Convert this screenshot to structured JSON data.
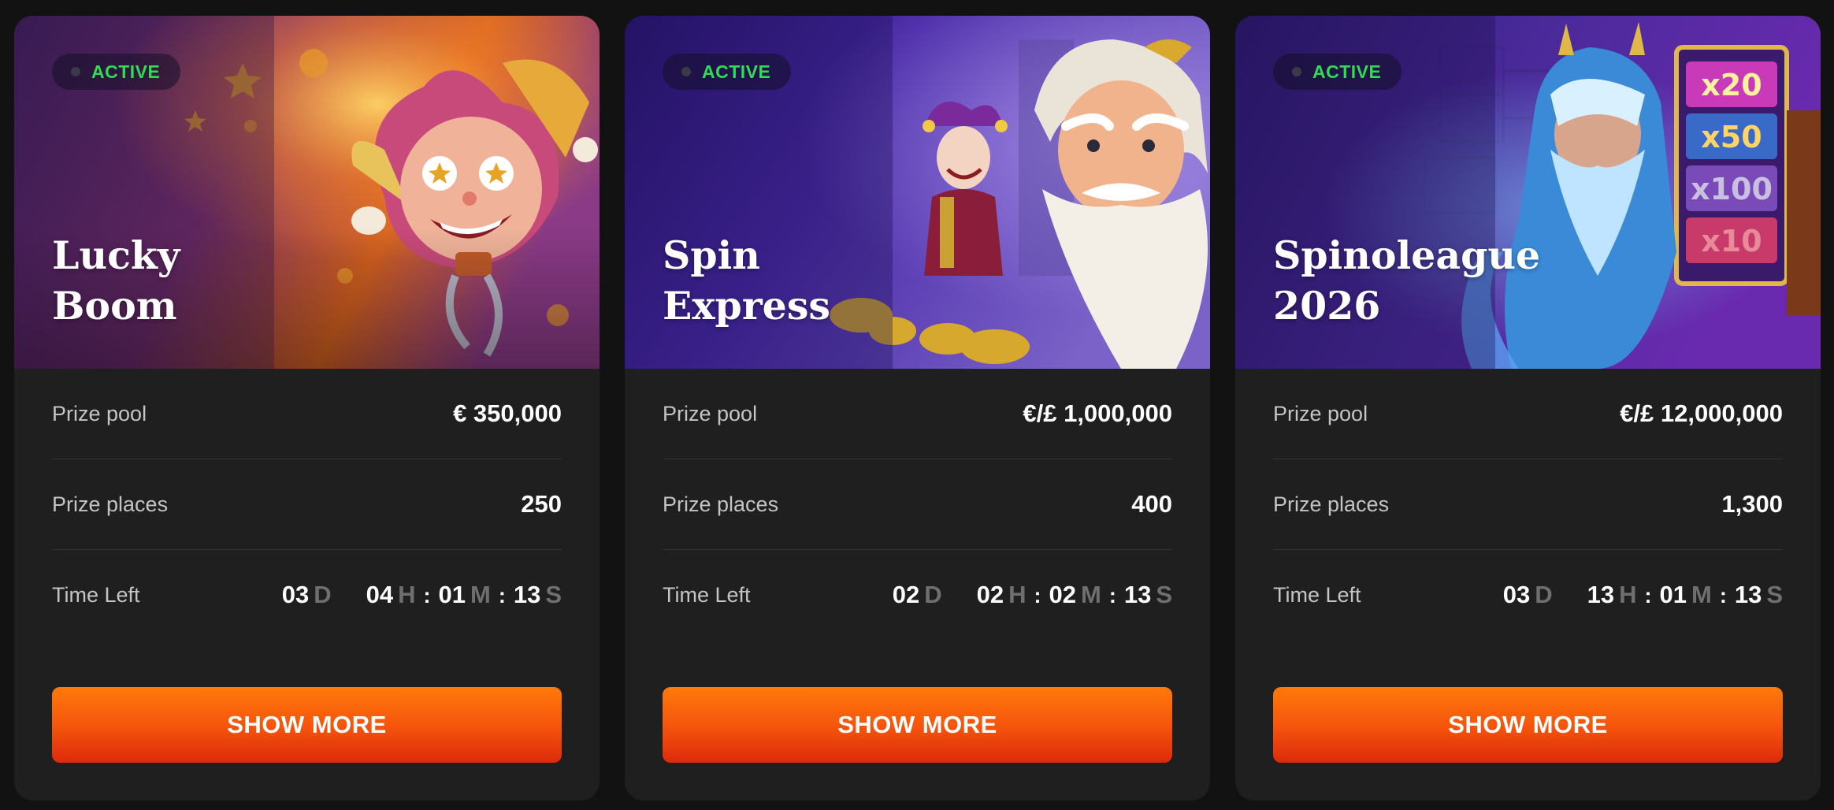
{
  "tournaments": [
    {
      "status": "ACTIVE",
      "title": "Lucky\nBoom",
      "rows": {
        "prize_pool_label": "Prize pool",
        "prize_pool": "€ 350,000",
        "prize_places_label": "Prize places",
        "prize_places": "250",
        "time_left_label": "Time Left"
      },
      "timer": {
        "d": "03",
        "d_unit": "D",
        "h": "04",
        "h_unit": "H",
        "m": "01",
        "m_unit": "M",
        "s": "13",
        "s_unit": "S",
        "sep": ":"
      },
      "button": "SHOW MORE",
      "colors": {
        "banner_a": "#5a2a7a",
        "banner_b": "#c8561d",
        "glow": "#ffb23a"
      }
    },
    {
      "status": "ACTIVE",
      "title": "Spin\nExpress",
      "rows": {
        "prize_pool_label": "Prize pool",
        "prize_pool": "€/£ 1,000,000",
        "prize_places_label": "Prize places",
        "prize_places": "400",
        "time_left_label": "Time Left"
      },
      "timer": {
        "d": "02",
        "d_unit": "D",
        "h": "02",
        "h_unit": "H",
        "m": "02",
        "m_unit": "M",
        "s": "13",
        "s_unit": "S",
        "sep": ":"
      },
      "button": "SHOW MORE",
      "colors": {
        "banner_a": "#3a1f8f",
        "banner_b": "#7a5ac8",
        "glow": "#e8c98a"
      }
    },
    {
      "status": "ACTIVE",
      "title": "Spinoleague\n2026",
      "rows": {
        "prize_pool_label": "Prize pool",
        "prize_pool": "€/£ 12,000,000",
        "prize_places_label": "Prize places",
        "prize_places": "1,300",
        "time_left_label": "Time Left"
      },
      "timer": {
        "d": "03",
        "d_unit": "D",
        "h": "13",
        "h_unit": "H",
        "m": "01",
        "m_unit": "M",
        "s": "13",
        "s_unit": "S",
        "sep": ":"
      },
      "button": "SHOW MORE",
      "multipliers": [
        "x20",
        "x50",
        "x100",
        "x10"
      ],
      "colors": {
        "banner_a": "#4a2a9a",
        "banner_b": "#2a5ad8",
        "glow": "#7fd0ff"
      }
    }
  ]
}
